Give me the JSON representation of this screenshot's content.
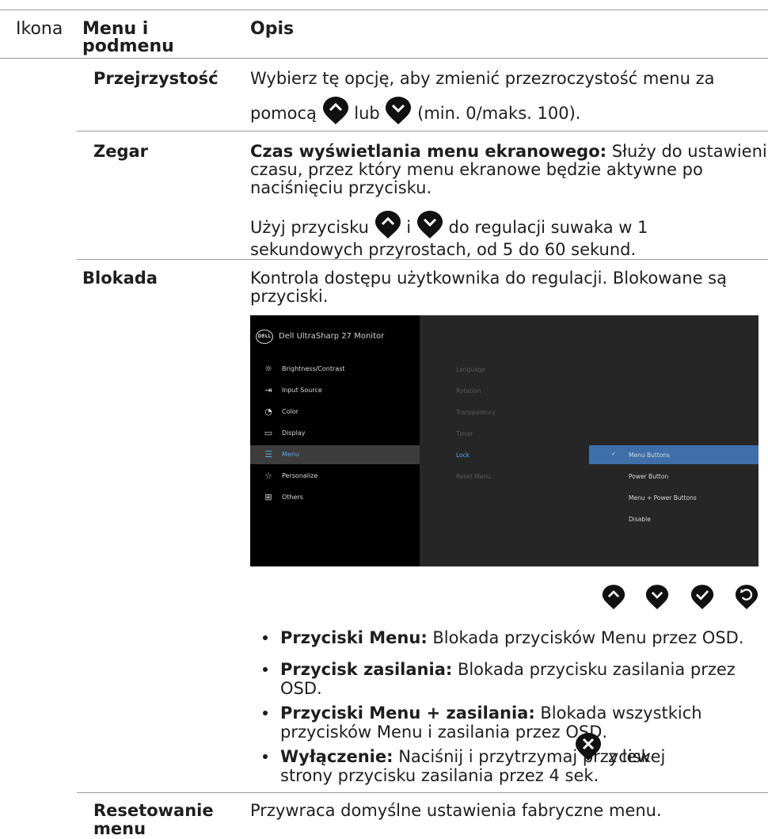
{
  "header": {
    "col_icon": "Ikona",
    "col_menu_line1": "Menu i",
    "col_menu_line2": "podmenu",
    "col_desc": "Opis"
  },
  "rows": {
    "transparency": {
      "name": "Przejrzystość",
      "line1": "Wybierz tę opcję, aby zmienić przezroczystość menu za",
      "line2_a": "pomocą",
      "line2_b": "lub",
      "line2_c": "(min. 0/maks. 100)."
    },
    "timer": {
      "name": "Zegar",
      "bold": "Czas wyświetlania menu ekranowego:",
      "line1_rest": " Służy do ustawienia",
      "line2": "czasu, przez który menu ekranowe będzie aktywne po",
      "line3": "naciśnięciu przycisku.",
      "line4_a": "Użyj przycisku",
      "line4_b": "i",
      "line4_c": "do regulacji suwaka w 1",
      "line5": "sekundowych przyrostach, od 5 do 60 sekund."
    },
    "lock": {
      "name": "Blokada",
      "line1": "Kontrola dostępu użytkownika do regulacji. Blokowane są",
      "line2": "przyciski."
    },
    "reset": {
      "name_line1": "Resetowanie",
      "name_line2": "menu",
      "desc": "Przywraca domyślne ustawienia fabryczne menu."
    }
  },
  "osd": {
    "logo": "DELL",
    "title": "Dell UltraSharp 27 Monitor",
    "menu": [
      {
        "icon": "brightness-icon",
        "glyph": "☼",
        "label": "Brightness/Contrast"
      },
      {
        "icon": "input-source-icon",
        "glyph": "⇥",
        "label": "Input Source"
      },
      {
        "icon": "color-icon",
        "glyph": "◔",
        "label": "Color"
      },
      {
        "icon": "display-icon",
        "glyph": "▭",
        "label": "Display"
      },
      {
        "icon": "menu-icon",
        "glyph": "☰",
        "label": "Menu"
      },
      {
        "icon": "star-icon",
        "glyph": "☆",
        "label": "Personalize"
      },
      {
        "icon": "others-icon",
        "glyph": "⊞",
        "label": "Others"
      }
    ],
    "selected_menu": "Menu",
    "submenu": [
      "Language",
      "Rotation",
      "Transparency",
      "Timer",
      "Lock",
      "Reset Menu"
    ],
    "active_submenu": "Lock",
    "options": [
      "Menu Buttons",
      "Power Button",
      "Menu + Power Buttons",
      "Disable"
    ],
    "selected_option": "Menu Buttons",
    "check": "✓"
  },
  "nav_buttons": [
    "up-icon",
    "down-icon",
    "check-icon",
    "back-icon"
  ],
  "bullets": [
    {
      "bold": "Przyciski Menu:",
      "text": " Blokada przycisków Menu przez OSD."
    },
    {
      "bold": "Przycisk zasilania:",
      "text": " Blokada przycisku zasilania przez",
      "text2": "OSD."
    },
    {
      "bold": "Przyciski Menu + zasilania:",
      "text": " Blokada wszystkich",
      "text2": "przycisków Menu i zasilania przez OSD."
    },
    {
      "bold": "Wyłączenie:",
      "text": " Naciśnij i przytrzymaj przycisk",
      "text_after": "z lewej",
      "text2": "strony przycisku zasilania przez 4 sek."
    }
  ],
  "colors": {
    "osd_selected_option": "#3e6fa8",
    "osd_active_text": "#5fa8e6",
    "rule": "#9a9a9a"
  }
}
